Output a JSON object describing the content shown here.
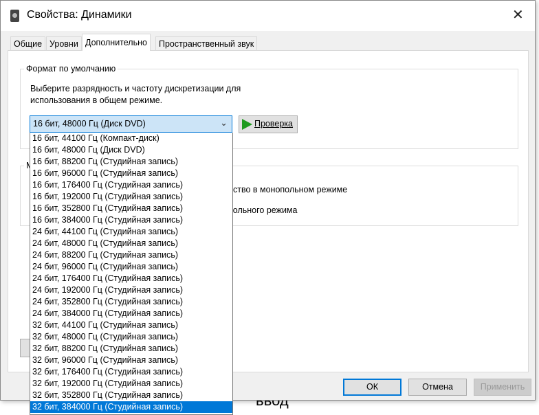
{
  "window": {
    "title": "Свойства: Динамики",
    "close": "✕"
  },
  "tabs": [
    {
      "label": "Общие"
    },
    {
      "label": "Уровни"
    },
    {
      "label": "Дополнительно"
    },
    {
      "label": "Пространственный звук"
    }
  ],
  "default_format": {
    "group_label": "Формат по умолчанию",
    "description_line1": "Выберите разрядность и частоту дискретизации для",
    "description_line2": "использования в общем режиме.",
    "selected": "16 бит, 48000 Гц (Диск DVD)",
    "test_button": "Проверка"
  },
  "exclusive": {
    "group_label": "М",
    "option1": "йство в монопольном режиме",
    "option2": "польного режима"
  },
  "dropdown_options": [
    "16 бит, 44100 Гц (Компакт-диск)",
    "16 бит, 48000 Гц (Диск DVD)",
    "16 бит, 88200 Гц (Студийная запись)",
    "16 бит, 96000 Гц (Студийная запись)",
    "16 бит, 176400 Гц (Студийная запись)",
    "16 бит, 192000 Гц (Студийная запись)",
    "16 бит, 352800 Гц (Студийная запись)",
    "16 бит, 384000 Гц (Студийная запись)",
    "24 бит, 44100 Гц (Студийная запись)",
    "24 бит, 48000 Гц (Студийная запись)",
    "24 бит, 88200 Гц (Студийная запись)",
    "24 бит, 96000 Гц (Студийная запись)",
    "24 бит, 176400 Гц (Студийная запись)",
    "24 бит, 192000 Гц (Студийная запись)",
    "24 бит, 352800 Гц (Студийная запись)",
    "24 бит, 384000 Гц (Студийная запись)",
    "32 бит, 44100 Гц (Студийная запись)",
    "32 бит, 48000 Гц (Студийная запись)",
    "32 бит, 88200 Гц (Студийная запись)",
    "32 бит, 96000 Гц (Студийная запись)",
    "32 бит, 176400 Гц (Студийная запись)",
    "32 бит, 192000 Гц (Студийная запись)",
    "32 бит, 352800 Гц (Студийная запись)",
    "32 бит, 384000 Гц (Студийная запись)"
  ],
  "highlighted_index": 23,
  "buttons": {
    "ok": "ОК",
    "cancel": "Отмена",
    "apply": "Применить"
  },
  "background": {
    "text": "ввод"
  },
  "colors": {
    "accent": "#0078d7",
    "selection_bg": "#cce4f7",
    "play": "#1e9b1e"
  }
}
